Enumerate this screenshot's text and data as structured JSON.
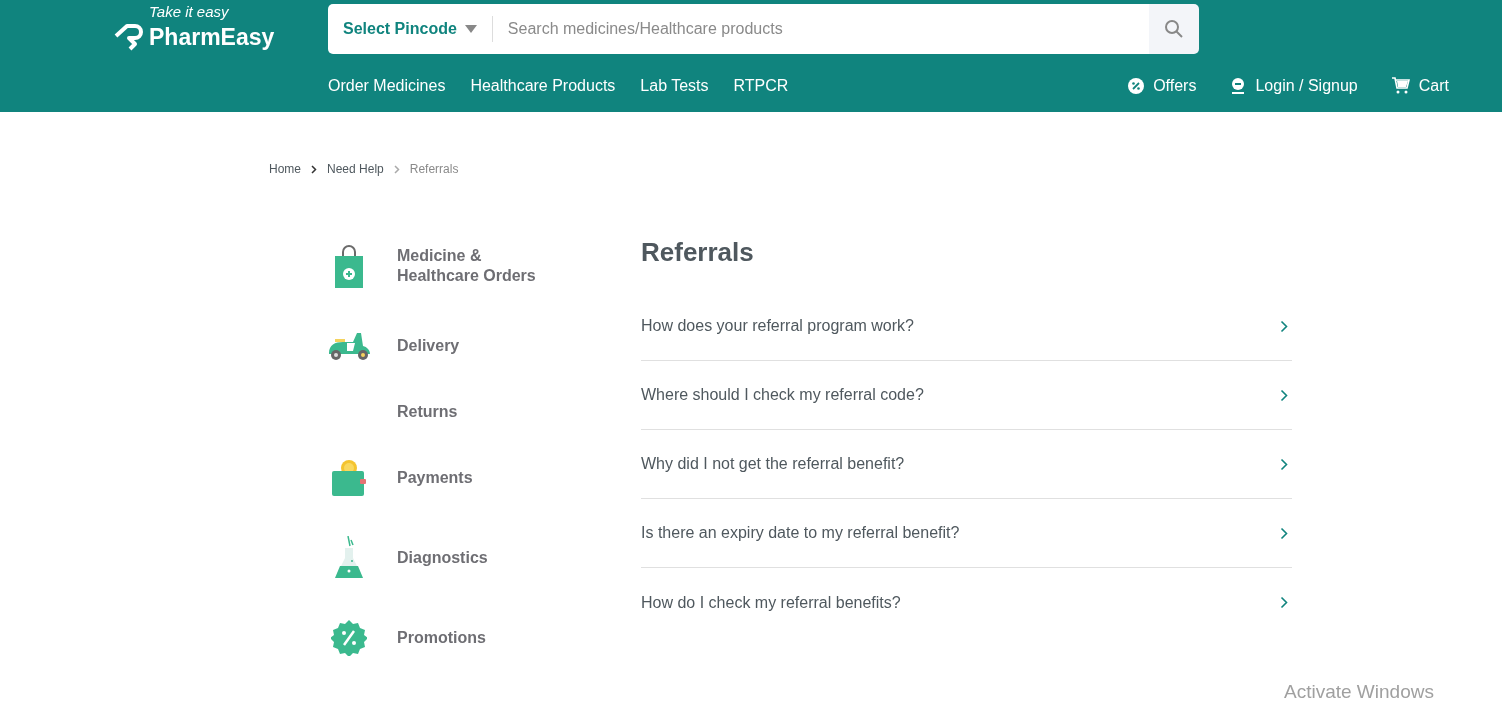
{
  "header": {
    "tagline": "Take it easy",
    "brand": "PharmEasy",
    "pincode": "Select Pincode",
    "search": {
      "placeholder": "Search medicines/Healthcare products"
    },
    "nav": [
      "Order Medicines",
      "Healthcare Products",
      "Lab Tests",
      "RTPCR"
    ],
    "actions": [
      {
        "kind": "offers",
        "label": "Offers"
      },
      {
        "kind": "login",
        "label": "Login / Signup"
      },
      {
        "kind": "cart",
        "label": "Cart"
      }
    ]
  },
  "breadcrumb": [
    {
      "label": "Home",
      "current": false
    },
    {
      "label": "Need Help",
      "current": false
    },
    {
      "label": "Referrals",
      "current": true
    }
  ],
  "sidebar": {
    "items": [
      {
        "kind": "bag",
        "label": "Medicine & Healthcare Orders"
      },
      {
        "kind": "scooter",
        "label": "Delivery"
      },
      {
        "kind": "none",
        "label": "Returns"
      },
      {
        "kind": "wallet",
        "label": "Payments"
      },
      {
        "kind": "flask",
        "label": "Diagnostics"
      },
      {
        "kind": "badge",
        "label": "Promotions"
      }
    ]
  },
  "section": {
    "title": "Referrals",
    "questions": [
      "How does your referral program work?",
      "Where should I check my referral code?",
      "Why did I not get the referral benefit?",
      "Is there an expiry date to my referral benefit?",
      "How do I check my referral benefits?"
    ]
  },
  "os_overlay": {
    "text": "Activate Windows"
  }
}
